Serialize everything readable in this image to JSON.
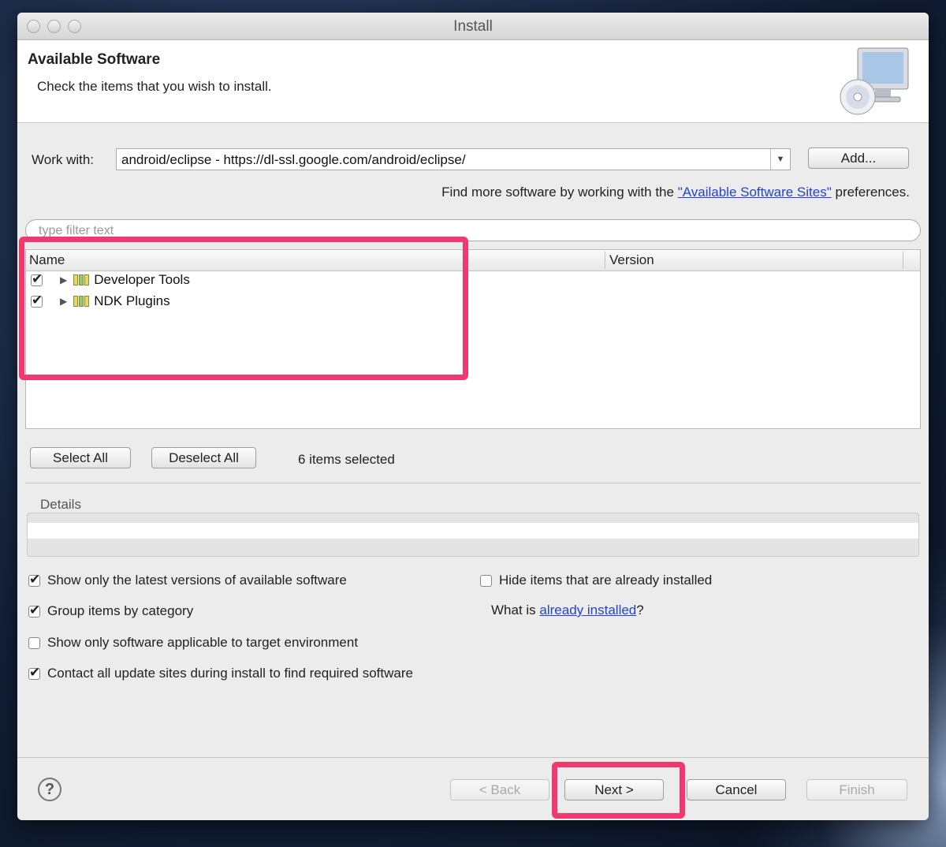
{
  "window": {
    "title": "Install"
  },
  "header": {
    "title": "Available Software",
    "subtitle": "Check the items that you wish to install.",
    "image_icon": "cd-computer-icon"
  },
  "work_with": {
    "label": "Work with:",
    "value": "android/eclipse - https://dl-ssl.google.com/android/eclipse/",
    "add_button": "Add..."
  },
  "find_more": {
    "prefix": "Find more software by working with the ",
    "link": "\"Available Software Sites\"",
    "suffix": " preferences."
  },
  "filter": {
    "placeholder": "type filter text"
  },
  "tree": {
    "columns": [
      "Name",
      "Version"
    ],
    "items": [
      {
        "label": "Developer Tools",
        "checked": true
      },
      {
        "label": "NDK Plugins",
        "checked": true
      }
    ]
  },
  "selection": {
    "select_all": "Select All",
    "deselect_all": "Deselect All",
    "status": "6 items selected"
  },
  "details": {
    "label": "Details"
  },
  "options": {
    "latest_versions": "Show only the latest versions of available software",
    "group_by_category": "Group items by category",
    "target_env": "Show only software applicable to target environment",
    "contact_sites": "Contact all update sites during install to find required software",
    "hide_installed": "Hide items that are already installed",
    "what_is_prefix": "What is ",
    "what_is_link": "already installed",
    "what_is_suffix": "?"
  },
  "footer": {
    "back": "< Back",
    "next": "Next >",
    "cancel": "Cancel",
    "finish": "Finish",
    "help_icon": "question-mark-icon"
  },
  "highlight_color": "#f0396f"
}
